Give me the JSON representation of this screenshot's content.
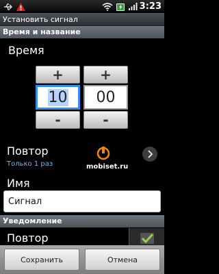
{
  "status_bar": {
    "time": "3:23",
    "icons": [
      "usb-icon",
      "warning-icon",
      "wifi-icon",
      "battery-charging-icon",
      "signal-icon"
    ]
  },
  "window": {
    "title": "Установить сигнал"
  },
  "time_section": {
    "header": "Время и название",
    "label": "Время",
    "hour": {
      "value": "10",
      "increment_label": "+",
      "decrement_label": "-"
    },
    "minute": {
      "value": "00",
      "increment_label": "+",
      "decrement_label": "-"
    }
  },
  "repeat_row": {
    "title": "Повтор",
    "subtitle": "Только 1 раз"
  },
  "name_field": {
    "label": "Имя",
    "value": "Сигнал"
  },
  "notification_section": {
    "header": "Уведомление",
    "repeat_label": "Повтор",
    "repeat_checked": true
  },
  "watermark": "mobiset.ru",
  "footer": {
    "save_label": "Сохранить",
    "cancel_label": "Отмена"
  },
  "colors": {
    "accent": "#2f8ff0",
    "subtitle": "#6fb6ff",
    "warning": "#e02020",
    "brand_logo": "#f08a00"
  }
}
